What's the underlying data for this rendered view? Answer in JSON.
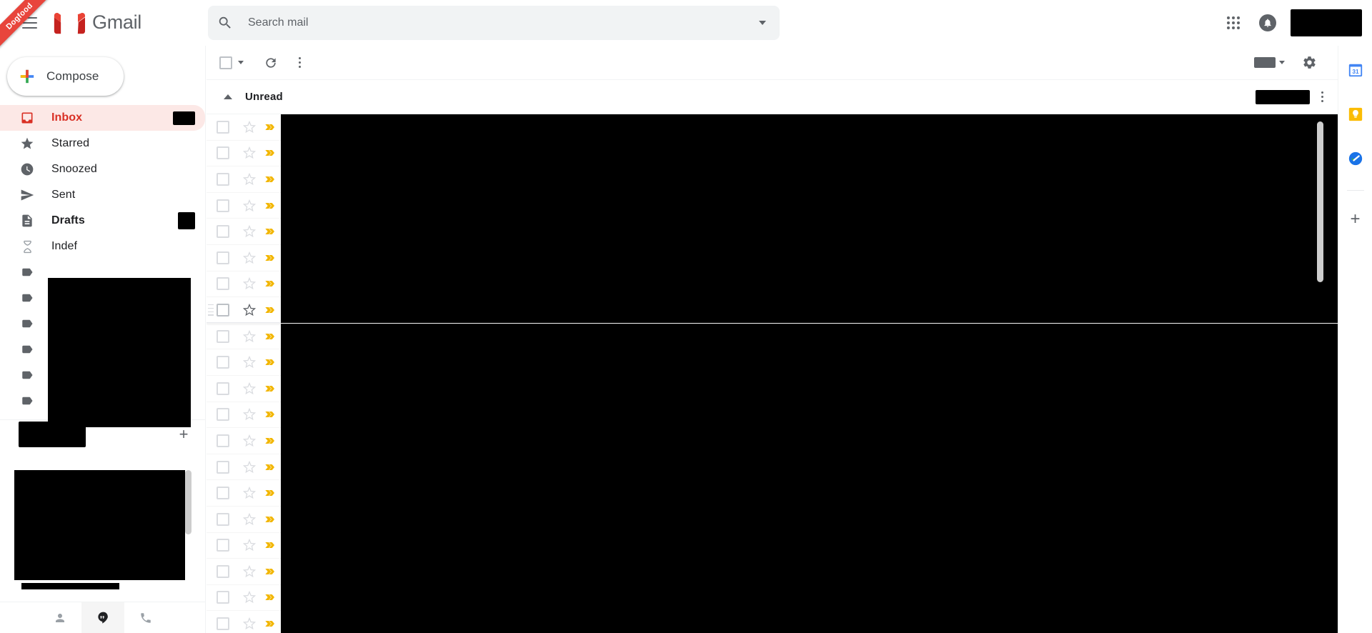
{
  "ribbon": {
    "label": "Dogfood"
  },
  "header": {
    "menu_icon": "hamburger-menu-icon",
    "brand": "Gmail",
    "logo_icon": "gmail-logo-icon",
    "apps_icon": "google-apps-grid-icon",
    "notifications_icon": "bell-icon",
    "account_label": ""
  },
  "search": {
    "placeholder": "Search mail",
    "value": "",
    "search_icon": "search-icon",
    "options_icon": "chevron-down-icon"
  },
  "sidebar": {
    "compose": {
      "label": "Compose",
      "icon": "plus-icon"
    },
    "items": [
      {
        "label": "Inbox",
        "icon": "inbox-icon",
        "active": true,
        "bold": true,
        "badge": ""
      },
      {
        "label": "Starred",
        "icon": "star-icon",
        "active": false,
        "bold": false,
        "badge": null
      },
      {
        "label": "Snoozed",
        "icon": "clock-icon",
        "active": false,
        "bold": false,
        "badge": null
      },
      {
        "label": "Sent",
        "icon": "send-icon",
        "active": false,
        "bold": false,
        "badge": null
      },
      {
        "label": "Drafts",
        "icon": "draft-icon",
        "active": false,
        "bold": true,
        "badge": ""
      },
      {
        "label": "Indef",
        "icon": "hourglass-icon",
        "active": false,
        "bold": false,
        "badge": null
      }
    ],
    "labels": [
      {
        "label": "",
        "icon": "label-tag-icon"
      },
      {
        "label": "",
        "icon": "label-tag-icon"
      },
      {
        "label": "",
        "icon": "label-tag-icon"
      },
      {
        "label": "",
        "icon": "label-tag-icon"
      },
      {
        "label": "",
        "icon": "label-tag-icon"
      },
      {
        "label": "",
        "icon": "label-tag-icon"
      }
    ],
    "chat_section": {
      "title": "",
      "add_icon": "plus-icon",
      "add_label": "+"
    },
    "chat_tabs": [
      {
        "name": "contacts",
        "icon": "person-icon",
        "active": false
      },
      {
        "name": "chat",
        "icon": "hangouts-icon",
        "active": true
      },
      {
        "name": "calls",
        "icon": "phone-icon",
        "active": false
      }
    ]
  },
  "toolbar": {
    "select_all": {
      "icon": "checkbox-icon",
      "caret": "chevron-down-icon"
    },
    "refresh": {
      "icon": "refresh-icon"
    },
    "more": {
      "icon": "more-vertical-icon"
    },
    "density": {
      "icon": "input-tools-icon",
      "caret": "chevron-down-icon"
    },
    "settings": {
      "icon": "gear-icon"
    }
  },
  "section": {
    "collapse_icon": "chevron-up-icon",
    "title": "Unread",
    "count": "",
    "menu_icon": "more-vertical-icon"
  },
  "mail_rows": [
    {
      "checkbox_icon": "checkbox-icon",
      "star_icon": "star-outline-icon",
      "importance_icon": "importance-marker-icon",
      "hover": false
    },
    {
      "checkbox_icon": "checkbox-icon",
      "star_icon": "star-outline-icon",
      "importance_icon": "importance-marker-icon",
      "hover": false
    },
    {
      "checkbox_icon": "checkbox-icon",
      "star_icon": "star-outline-icon",
      "importance_icon": "importance-marker-icon",
      "hover": false
    },
    {
      "checkbox_icon": "checkbox-icon",
      "star_icon": "star-outline-icon",
      "importance_icon": "importance-marker-icon",
      "hover": false
    },
    {
      "checkbox_icon": "checkbox-icon",
      "star_icon": "star-outline-icon",
      "importance_icon": "importance-marker-icon",
      "hover": false
    },
    {
      "checkbox_icon": "checkbox-icon",
      "star_icon": "star-outline-icon",
      "importance_icon": "importance-marker-icon",
      "hover": false
    },
    {
      "checkbox_icon": "checkbox-icon",
      "star_icon": "star-outline-icon",
      "importance_icon": "importance-marker-icon",
      "hover": false
    },
    {
      "checkbox_icon": "checkbox-icon",
      "star_icon": "star-outline-icon",
      "importance_icon": "importance-marker-icon",
      "hover": true
    },
    {
      "checkbox_icon": "checkbox-icon",
      "star_icon": "star-outline-icon",
      "importance_icon": "importance-marker-icon",
      "hover": false
    },
    {
      "checkbox_icon": "checkbox-icon",
      "star_icon": "star-outline-icon",
      "importance_icon": "importance-marker-icon",
      "hover": false
    },
    {
      "checkbox_icon": "checkbox-icon",
      "star_icon": "star-outline-icon",
      "importance_icon": "importance-marker-icon",
      "hover": false
    },
    {
      "checkbox_icon": "checkbox-icon",
      "star_icon": "star-outline-icon",
      "importance_icon": "importance-marker-icon",
      "hover": false
    },
    {
      "checkbox_icon": "checkbox-icon",
      "star_icon": "star-outline-icon",
      "importance_icon": "importance-marker-icon",
      "hover": false
    },
    {
      "checkbox_icon": "checkbox-icon",
      "star_icon": "star-outline-icon",
      "importance_icon": "importance-marker-icon",
      "hover": false
    },
    {
      "checkbox_icon": "checkbox-icon",
      "star_icon": "star-outline-icon",
      "importance_icon": "importance-marker-icon",
      "hover": false
    },
    {
      "checkbox_icon": "checkbox-icon",
      "star_icon": "star-outline-icon",
      "importance_icon": "importance-marker-icon",
      "hover": false
    },
    {
      "checkbox_icon": "checkbox-icon",
      "star_icon": "star-outline-icon",
      "importance_icon": "importance-marker-icon",
      "hover": false
    },
    {
      "checkbox_icon": "checkbox-icon",
      "star_icon": "star-outline-icon",
      "importance_icon": "importance-marker-icon",
      "hover": false
    },
    {
      "checkbox_icon": "checkbox-icon",
      "star_icon": "star-outline-icon",
      "importance_icon": "importance-marker-icon",
      "hover": false
    },
    {
      "checkbox_icon": "checkbox-icon",
      "star_icon": "star-outline-icon",
      "importance_icon": "importance-marker-icon",
      "hover": false
    }
  ],
  "addons": [
    {
      "name": "google-calendar",
      "icon": "calendar-icon",
      "label": "31"
    },
    {
      "name": "google-keep",
      "icon": "keep-bulb-icon",
      "label": ""
    },
    {
      "name": "google-tasks",
      "icon": "tasks-icon",
      "label": ""
    }
  ],
  "addons_add": {
    "icon": "plus-icon",
    "label": "+"
  },
  "colors": {
    "brand_red": "#d93025",
    "gmail_red": "#ea4335",
    "inbox_highlight": "#fce8e6",
    "importance_gold": "#f2b600",
    "icon_grey": "#5f6368",
    "divider": "#f1f3f4",
    "calendar_blue": "#4285f4",
    "keep_yellow": "#fbbc04",
    "tasks_blue": "#1a73e8",
    "redaction": "#000000"
  }
}
